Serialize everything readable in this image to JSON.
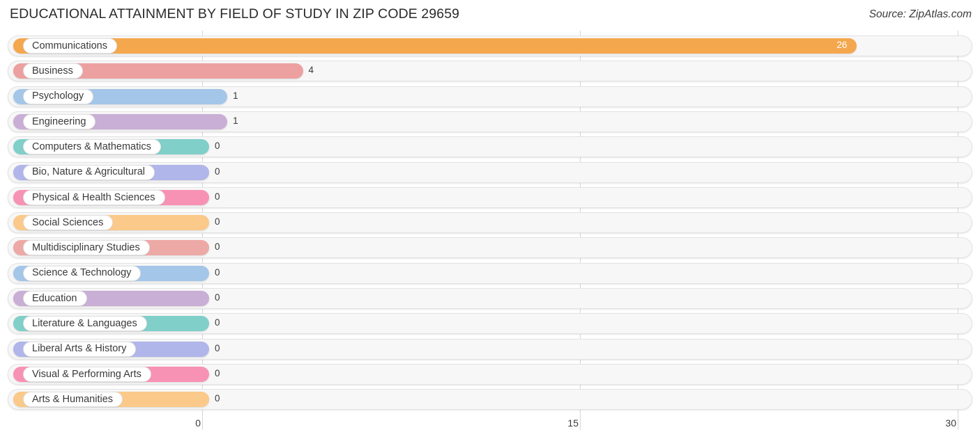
{
  "header": {
    "title": "EDUCATIONAL ATTAINMENT BY FIELD OF STUDY IN ZIP CODE 29659",
    "source": "Source: ZipAtlas.com"
  },
  "chart_data": {
    "type": "bar",
    "orientation": "horizontal",
    "title": "EDUCATIONAL ATTAINMENT BY FIELD OF STUDY IN ZIP CODE 29659",
    "xlabel": "",
    "ylabel": "",
    "xlim": [
      0,
      30
    ],
    "xticks": [
      0,
      15,
      30
    ],
    "xtick_labels": [
      "0",
      "15",
      "30"
    ],
    "grid": true,
    "legend": false,
    "categories": [
      "Communications",
      "Business",
      "Psychology",
      "Engineering",
      "Computers & Mathematics",
      "Bio, Nature & Agricultural",
      "Physical & Health Sciences",
      "Social Sciences",
      "Multidisciplinary Studies",
      "Science & Technology",
      "Education",
      "Literature & Languages",
      "Liberal Arts & History",
      "Visual & Performing Arts",
      "Arts & Humanities"
    ],
    "values": [
      26,
      4,
      1,
      1,
      0,
      0,
      0,
      0,
      0,
      0,
      0,
      0,
      0,
      0,
      0
    ],
    "value_labels": [
      "26",
      "4",
      "1",
      "1",
      "0",
      "0",
      "0",
      "0",
      "0",
      "0",
      "0",
      "0",
      "0",
      "0",
      "0"
    ],
    "bar_colors": [
      "#f5a74e",
      "#eda0a0",
      "#a4c6e8",
      "#c9aed5",
      "#80cfc9",
      "#b0b6e9",
      "#f892b5",
      "#fbc98a",
      "#eda9a6",
      "#a4c6e8",
      "#c9aed5",
      "#80cfc9",
      "#b0b6e9",
      "#f892b5",
      "#fbc98a"
    ]
  },
  "axis": {
    "ticks": [
      "0",
      "15",
      "30"
    ]
  }
}
